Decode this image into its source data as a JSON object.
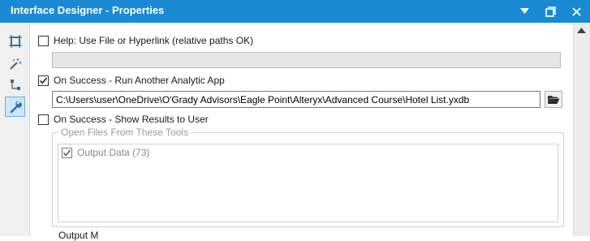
{
  "window": {
    "title": "Interface Designer - Properties",
    "controls": {
      "menu_icon": "dropdown-triangle-icon",
      "restore_icon": "restore-window-icon",
      "close_icon": "close-icon"
    },
    "accent": "#1a8ad4"
  },
  "sidebar": {
    "items": [
      {
        "icon": "layout-icon",
        "active": false
      },
      {
        "icon": "magic-wand-icon",
        "active": false
      },
      {
        "icon": "tree-icon",
        "active": false
      },
      {
        "icon": "wrench-icon",
        "active": true
      }
    ]
  },
  "help": {
    "checkbox_label": "Help: Use File or Hyperlink (relative paths OK)",
    "checked": false,
    "value": ""
  },
  "on_success_run": {
    "checkbox_label": "On Success - Run Another Analytic App",
    "checked": true,
    "path": "C:\\Users\\user\\OneDrive\\O'Grady Advisors\\Eagle Point\\Alteryx\\Advanced Course\\Hotel List.yxdb",
    "browse_icon": "folder-open-icon"
  },
  "on_success_show": {
    "checkbox_label": "On Success - Show Results to User",
    "checked": false,
    "group_label": "Open Files From These Tools",
    "tools": [
      {
        "label": "Output Data (73)",
        "checked": true
      }
    ]
  },
  "cutoff_text": "Output M"
}
